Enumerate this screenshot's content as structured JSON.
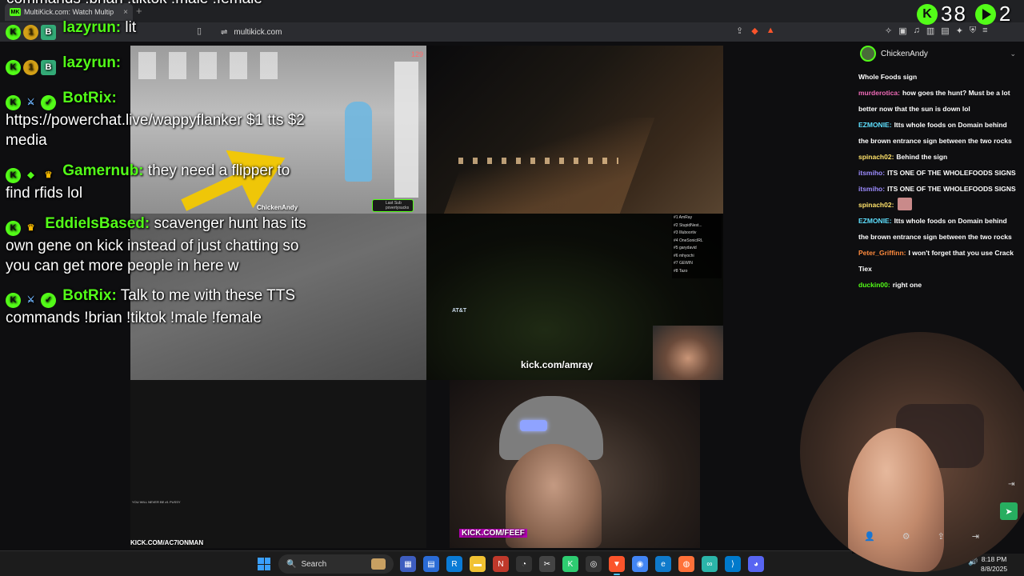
{
  "top_caption": "commands !brian !tiktok !male !female",
  "browser": {
    "tab_title": "MultiKick.com: Watch Multip",
    "tab_favicon": "MK",
    "url": "multikick.com"
  },
  "overlay_counter": {
    "value": "38",
    "next_value": "2"
  },
  "overlay_chat": [
    {
      "user": "lazyrun:",
      "text": "lit"
    },
    {
      "user": "lazyrun:",
      "text": ""
    },
    {
      "user": "BotRix:",
      "text": "https://powerchat.live/wappyflanker $1 tts $2 media"
    },
    {
      "user": "Gamernub:",
      "text": "they need a flipper to find rfids lol"
    },
    {
      "user": "EddieIsBased:",
      "text": "scavenger hunt has its own gene on kick instead of just chatting so you can get more people in here w"
    },
    {
      "user": "BotRix:",
      "text": "Talk to me with these TTS commands !brian !tiktok !male !female"
    }
  ],
  "tiles": {
    "t1": {
      "label": "ChickenAndy",
      "viewers": "129",
      "alert_title": "Last Sub",
      "alert_user": "povertysucks"
    },
    "t2": {
      "label": ""
    },
    "t3": {
      "label": ""
    },
    "t4": {
      "label": "kick.com/amray",
      "sign": "AT&T",
      "leaderboard": [
        "#1 AmRay",
        "#2 StupidNest...",
        "#3 Illuboortiv",
        "#4 OneSonicIRL",
        "#5 garydavid",
        "#6 mhyochi",
        "#7 GEWIN",
        "#8 Tazo"
      ]
    },
    "t5": {
      "label": "KICK.COM/AC7IONMAN",
      "mini_chat": [
        "YOU WILL NEVER BE #1 PUSSY"
      ]
    },
    "t6": {
      "label": "KICK.COM/FEEF"
    }
  },
  "right_chat": {
    "channel": "ChickenAndy",
    "messages": [
      {
        "user": "",
        "user_color": "#ffffff",
        "text": "Whole Foods sign"
      },
      {
        "user": "murderotica:",
        "user_color": "#f06bb8",
        "text": "how goes the hunt? Must be a lot better now that the sun is down lol"
      },
      {
        "user": "EZMONIE:",
        "user_color": "#5ee0ff",
        "text": "Itts whole foods on Domain behind the brown entrance sign between the two rocks"
      },
      {
        "user": "spinach02:",
        "user_color": "#ffe26a",
        "text": "Behind the sign"
      },
      {
        "user": "itsmiho:",
        "user_color": "#9d8cff",
        "text": "ITS ONE OF THE WHOLEFOODS SIGNS"
      },
      {
        "user": "itsmiho:",
        "user_color": "#9d8cff",
        "text": "ITS ONE OF THE WHOLEFOODS SIGNS"
      },
      {
        "user": "spinach02:",
        "user_color": "#ffe26a",
        "text": ""
      },
      {
        "user": "EZMONIE:",
        "user_color": "#5ee0ff",
        "text": "Itts whole foods on Domain behind the brown entrance sign between the two rocks"
      },
      {
        "user": "Peter_Griffinn:",
        "user_color": "#ff8a3d",
        "text": "I won't forget that you use Crack Tiex"
      },
      {
        "user": "duckin00:",
        "user_color": "#53fc18",
        "text": "right one"
      }
    ]
  },
  "taskbar": {
    "search_placeholder": "Search",
    "time": "8:18 PM",
    "date": "8/8/2025"
  },
  "colors": {
    "kick_green": "#53fc18",
    "background": "#0e0e10",
    "taskbar": "#1c1c1c"
  }
}
